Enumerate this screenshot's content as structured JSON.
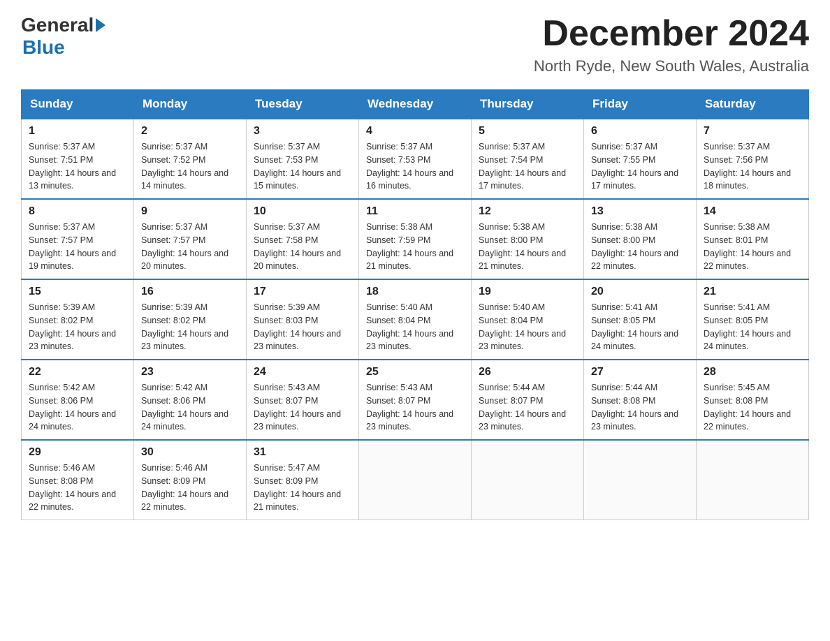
{
  "header": {
    "logo_general": "General",
    "logo_blue": "Blue",
    "month_title": "December 2024",
    "location": "North Ryde, New South Wales, Australia"
  },
  "weekdays": [
    "Sunday",
    "Monday",
    "Tuesday",
    "Wednesday",
    "Thursday",
    "Friday",
    "Saturday"
  ],
  "weeks": [
    [
      {
        "day": "1",
        "sunrise": "Sunrise: 5:37 AM",
        "sunset": "Sunset: 7:51 PM",
        "daylight": "Daylight: 14 hours and 13 minutes."
      },
      {
        "day": "2",
        "sunrise": "Sunrise: 5:37 AM",
        "sunset": "Sunset: 7:52 PM",
        "daylight": "Daylight: 14 hours and 14 minutes."
      },
      {
        "day": "3",
        "sunrise": "Sunrise: 5:37 AM",
        "sunset": "Sunset: 7:53 PM",
        "daylight": "Daylight: 14 hours and 15 minutes."
      },
      {
        "day": "4",
        "sunrise": "Sunrise: 5:37 AM",
        "sunset": "Sunset: 7:53 PM",
        "daylight": "Daylight: 14 hours and 16 minutes."
      },
      {
        "day": "5",
        "sunrise": "Sunrise: 5:37 AM",
        "sunset": "Sunset: 7:54 PM",
        "daylight": "Daylight: 14 hours and 17 minutes."
      },
      {
        "day": "6",
        "sunrise": "Sunrise: 5:37 AM",
        "sunset": "Sunset: 7:55 PM",
        "daylight": "Daylight: 14 hours and 17 minutes."
      },
      {
        "day": "7",
        "sunrise": "Sunrise: 5:37 AM",
        "sunset": "Sunset: 7:56 PM",
        "daylight": "Daylight: 14 hours and 18 minutes."
      }
    ],
    [
      {
        "day": "8",
        "sunrise": "Sunrise: 5:37 AM",
        "sunset": "Sunset: 7:57 PM",
        "daylight": "Daylight: 14 hours and 19 minutes."
      },
      {
        "day": "9",
        "sunrise": "Sunrise: 5:37 AM",
        "sunset": "Sunset: 7:57 PM",
        "daylight": "Daylight: 14 hours and 20 minutes."
      },
      {
        "day": "10",
        "sunrise": "Sunrise: 5:37 AM",
        "sunset": "Sunset: 7:58 PM",
        "daylight": "Daylight: 14 hours and 20 minutes."
      },
      {
        "day": "11",
        "sunrise": "Sunrise: 5:38 AM",
        "sunset": "Sunset: 7:59 PM",
        "daylight": "Daylight: 14 hours and 21 minutes."
      },
      {
        "day": "12",
        "sunrise": "Sunrise: 5:38 AM",
        "sunset": "Sunset: 8:00 PM",
        "daylight": "Daylight: 14 hours and 21 minutes."
      },
      {
        "day": "13",
        "sunrise": "Sunrise: 5:38 AM",
        "sunset": "Sunset: 8:00 PM",
        "daylight": "Daylight: 14 hours and 22 minutes."
      },
      {
        "day": "14",
        "sunrise": "Sunrise: 5:38 AM",
        "sunset": "Sunset: 8:01 PM",
        "daylight": "Daylight: 14 hours and 22 minutes."
      }
    ],
    [
      {
        "day": "15",
        "sunrise": "Sunrise: 5:39 AM",
        "sunset": "Sunset: 8:02 PM",
        "daylight": "Daylight: 14 hours and 23 minutes."
      },
      {
        "day": "16",
        "sunrise": "Sunrise: 5:39 AM",
        "sunset": "Sunset: 8:02 PM",
        "daylight": "Daylight: 14 hours and 23 minutes."
      },
      {
        "day": "17",
        "sunrise": "Sunrise: 5:39 AM",
        "sunset": "Sunset: 8:03 PM",
        "daylight": "Daylight: 14 hours and 23 minutes."
      },
      {
        "day": "18",
        "sunrise": "Sunrise: 5:40 AM",
        "sunset": "Sunset: 8:04 PM",
        "daylight": "Daylight: 14 hours and 23 minutes."
      },
      {
        "day": "19",
        "sunrise": "Sunrise: 5:40 AM",
        "sunset": "Sunset: 8:04 PM",
        "daylight": "Daylight: 14 hours and 23 minutes."
      },
      {
        "day": "20",
        "sunrise": "Sunrise: 5:41 AM",
        "sunset": "Sunset: 8:05 PM",
        "daylight": "Daylight: 14 hours and 24 minutes."
      },
      {
        "day": "21",
        "sunrise": "Sunrise: 5:41 AM",
        "sunset": "Sunset: 8:05 PM",
        "daylight": "Daylight: 14 hours and 24 minutes."
      }
    ],
    [
      {
        "day": "22",
        "sunrise": "Sunrise: 5:42 AM",
        "sunset": "Sunset: 8:06 PM",
        "daylight": "Daylight: 14 hours and 24 minutes."
      },
      {
        "day": "23",
        "sunrise": "Sunrise: 5:42 AM",
        "sunset": "Sunset: 8:06 PM",
        "daylight": "Daylight: 14 hours and 24 minutes."
      },
      {
        "day": "24",
        "sunrise": "Sunrise: 5:43 AM",
        "sunset": "Sunset: 8:07 PM",
        "daylight": "Daylight: 14 hours and 23 minutes."
      },
      {
        "day": "25",
        "sunrise": "Sunrise: 5:43 AM",
        "sunset": "Sunset: 8:07 PM",
        "daylight": "Daylight: 14 hours and 23 minutes."
      },
      {
        "day": "26",
        "sunrise": "Sunrise: 5:44 AM",
        "sunset": "Sunset: 8:07 PM",
        "daylight": "Daylight: 14 hours and 23 minutes."
      },
      {
        "day": "27",
        "sunrise": "Sunrise: 5:44 AM",
        "sunset": "Sunset: 8:08 PM",
        "daylight": "Daylight: 14 hours and 23 minutes."
      },
      {
        "day": "28",
        "sunrise": "Sunrise: 5:45 AM",
        "sunset": "Sunset: 8:08 PM",
        "daylight": "Daylight: 14 hours and 22 minutes."
      }
    ],
    [
      {
        "day": "29",
        "sunrise": "Sunrise: 5:46 AM",
        "sunset": "Sunset: 8:08 PM",
        "daylight": "Daylight: 14 hours and 22 minutes."
      },
      {
        "day": "30",
        "sunrise": "Sunrise: 5:46 AM",
        "sunset": "Sunset: 8:09 PM",
        "daylight": "Daylight: 14 hours and 22 minutes."
      },
      {
        "day": "31",
        "sunrise": "Sunrise: 5:47 AM",
        "sunset": "Sunset: 8:09 PM",
        "daylight": "Daylight: 14 hours and 21 minutes."
      },
      null,
      null,
      null,
      null
    ]
  ]
}
